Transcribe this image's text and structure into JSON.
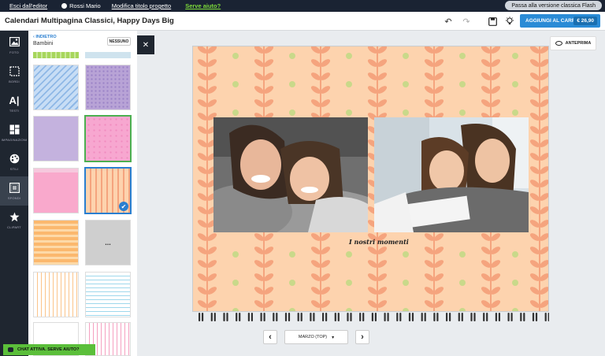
{
  "topbar": {
    "exit_label": "Esci dall'editor",
    "user_name": "Rossi Mario",
    "rename_label": "Modifica titolo progetto",
    "help_label": "Serve aiuto?",
    "flash_label": "Passa alla versione classica Flash"
  },
  "header": {
    "project_title": "Calendari Multipagina Classici, Happy Days Big",
    "cart_label": "AGGIUNGI AL CARRELLO",
    "cart_price": "€ 26,90"
  },
  "sidebar": {
    "items": [
      {
        "label": "FOTO",
        "icon": "image-icon"
      },
      {
        "label": "BORDI",
        "icon": "border-icon"
      },
      {
        "label": "TESTI",
        "icon": "text-icon"
      },
      {
        "label": "IMPAGINAZIONI",
        "icon": "layout-icon"
      },
      {
        "label": "STILI",
        "icon": "palette-icon"
      },
      {
        "label": "SFONDI",
        "icon": "background-icon"
      },
      {
        "label": "CLIPART",
        "icon": "clipart-icon"
      }
    ],
    "active": "SFONDI"
  },
  "panel": {
    "back_label": "INDIETRO",
    "title": "Bambini",
    "none_label": "NESSUNO",
    "more_label": "..."
  },
  "canvas": {
    "preview_label": "ANTEPRIMA",
    "photo_caption": "I nostri momenti"
  },
  "pager": {
    "month_label": "MARZO (TOP)"
  },
  "chat": {
    "label": "CHAT ATTIVA. SERVE AIUTO?"
  },
  "colors": {
    "topbar_bg": "#1a2333",
    "accent_blue": "#2a8bd6",
    "help_green": "#7ddc3a",
    "chat_green": "#5bbf3a",
    "page_bg": "#fdd3ae",
    "leaf_coral": "#f5a47e",
    "dot_green": "#c9d98a"
  }
}
